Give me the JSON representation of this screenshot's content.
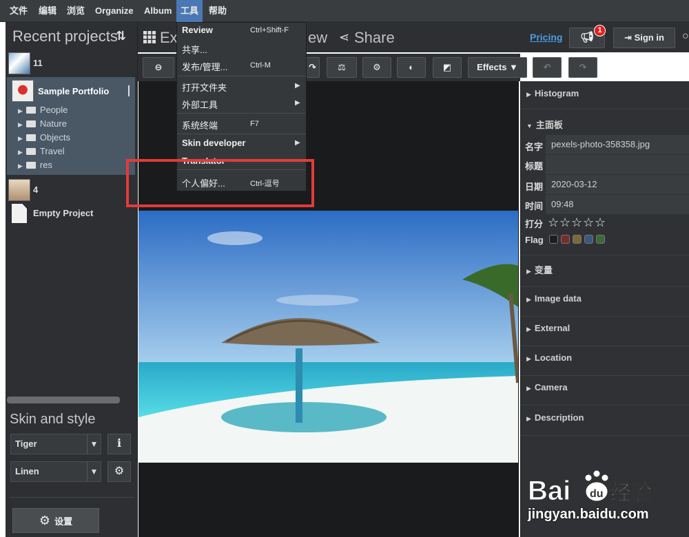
{
  "menubar": {
    "items": [
      "文件",
      "编辑",
      "浏览",
      "Organize",
      "Album",
      "工具",
      "帮助"
    ],
    "active": "工具"
  },
  "left": {
    "title": "Recent projects",
    "projects": [
      {
        "name": "11"
      },
      {
        "name": "Sample Portfolio",
        "selected": true
      },
      {
        "name": "4"
      },
      {
        "name": "Empty Project"
      }
    ],
    "folders": [
      "People",
      "Nature",
      "Objects",
      "Travel",
      "res"
    ],
    "skin_title": "Skin and style",
    "skin_value": "Tiger",
    "style_value": "Linen",
    "settings_label": "设置"
  },
  "topbar": {
    "tab_explore_partial": "Ex",
    "tab_view_partial": "ew",
    "tab_share": "Share",
    "pricing": "Pricing",
    "notifications": "1",
    "signin": "Sign in"
  },
  "toolbar": {
    "effects_label": "Effects ▼"
  },
  "dropdown": {
    "items": [
      {
        "label": "Review",
        "shortcut": "Ctrl+Shift-F"
      },
      {
        "label": "共享..."
      },
      {
        "label": "发布/管理...",
        "shortcut": "Ctrl-M"
      },
      {
        "label": "打开文件夹"
      },
      {
        "label": "外部工具"
      },
      {
        "label": "系统终端",
        "shortcut": "F7"
      },
      {
        "label": "Skin developer"
      },
      {
        "label": "Translator"
      },
      {
        "label": "个人偏好...",
        "shortcut": "Ctrl-逗号"
      }
    ]
  },
  "right": {
    "histogram": "Histogram",
    "main_panel": "主面板",
    "fields": [
      {
        "label": "名字",
        "value": "pexels-photo-358358.jpg"
      },
      {
        "label": "标题",
        "value": ""
      },
      {
        "label": "日期",
        "value": "2020-03-12"
      },
      {
        "label": "时间",
        "value": "09:48"
      }
    ],
    "rating_label": "打分",
    "flag_label": "Flag",
    "flag_colors": [
      "#1e1e1e",
      "#7a2b2b",
      "#7a6a36",
      "#3a5a7a",
      "#3a6a3a"
    ],
    "sections": [
      "变量",
      "Image data",
      "External",
      "Location",
      "Camera",
      "Description"
    ]
  },
  "watermark": {
    "logo": "Bai 经验",
    "url": "jingyan.baidu.com"
  }
}
